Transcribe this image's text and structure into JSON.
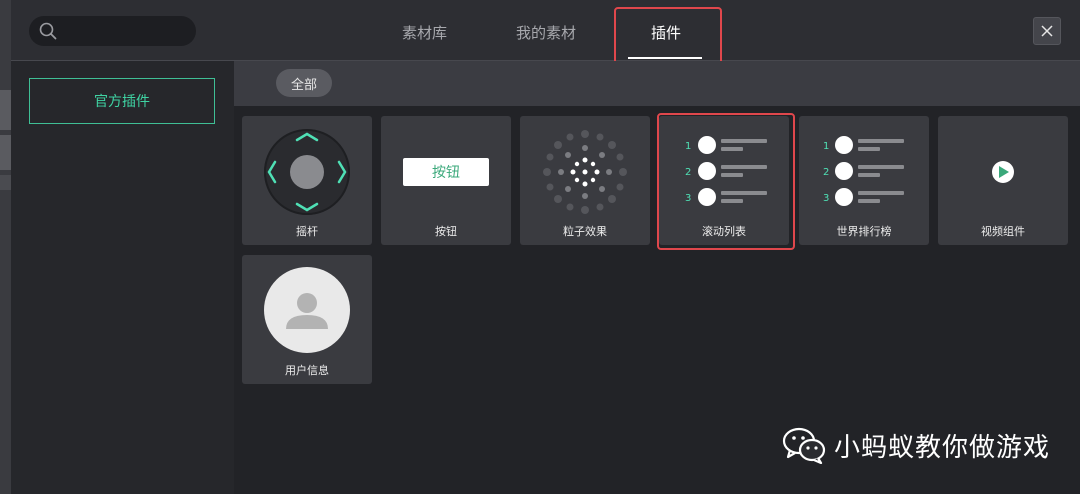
{
  "header": {
    "search": {
      "placeholder": ""
    },
    "tabs": [
      {
        "label": "素材库",
        "active": false
      },
      {
        "label": "我的素材",
        "active": false
      },
      {
        "label": "插件",
        "active": true
      }
    ],
    "close_icon": "close-icon"
  },
  "sidebar": {
    "items": [
      {
        "label": "官方插件",
        "selected": true
      }
    ]
  },
  "filter": {
    "chips": [
      {
        "label": "全部",
        "selected": true
      }
    ]
  },
  "plugins": [
    {
      "label": "摇杆",
      "icon": "joystick-icon"
    },
    {
      "label": "按钮",
      "icon": "button-icon",
      "demo_text": "按钮"
    },
    {
      "label": "粒子效果",
      "icon": "particle-icon"
    },
    {
      "label": "滚动列表",
      "icon": "scroll-list-icon",
      "numbers": [
        "1",
        "2",
        "3"
      ],
      "highlighted": true
    },
    {
      "label": "世界排行榜",
      "icon": "leaderboard-icon",
      "numbers": [
        "1",
        "2",
        "3"
      ]
    },
    {
      "label": "视频组件",
      "icon": "video-play-icon"
    },
    {
      "label": "用户信息",
      "icon": "user-avatar-icon"
    }
  ],
  "watermark": {
    "text": "小蚂蚁教你做游戏",
    "icon": "wechat-icon"
  },
  "colors": {
    "accent": "#3fd3a3",
    "highlight_box": "#e0474c",
    "card_bg": "#3a3b40",
    "content_bg": "#222327"
  }
}
